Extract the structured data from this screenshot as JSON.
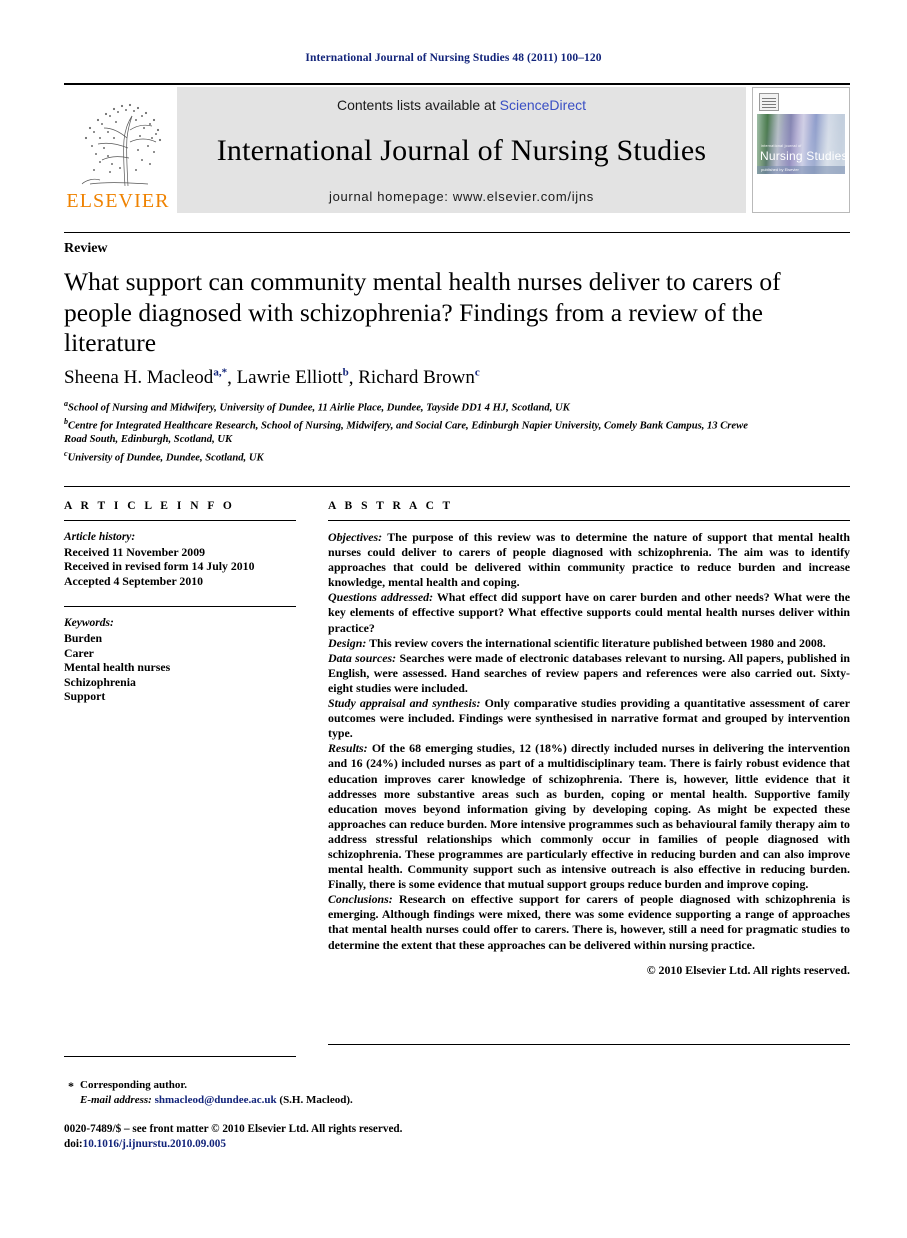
{
  "running_head": "International Journal of Nursing Studies 48 (2011) 100–120",
  "masthead": {
    "publisher_logo_text": "ELSEVIER",
    "contents_prefix": "Contents lists available at ",
    "sciencedirect": "ScienceDirect",
    "journal_title": "International Journal of Nursing Studies",
    "homepage": "journal homepage: www.elsevier.com/ijns",
    "cover": {
      "small_caption": "international journal of",
      "large_caption": "Nursing Studies",
      "band_caption": "published by Elsevier"
    }
  },
  "article": {
    "type": "Review",
    "title": "What support can community mental health nurses deliver to carers of people diagnosed with schizophrenia? Findings from a review of the literature",
    "authors": [
      {
        "name": "Sheena H. Macleod",
        "marks": "a,*"
      },
      {
        "name": "Lawrie Elliott",
        "marks": "b"
      },
      {
        "name": "Richard Brown",
        "marks": "c"
      }
    ],
    "affiliations": [
      {
        "mark": "a",
        "text": "School of Nursing and Midwifery, University of Dundee, 11 Airlie Place, Dundee, Tayside DD1 4 HJ, Scotland, UK"
      },
      {
        "mark": "b",
        "text": "Centre for Integrated Healthcare Research, School of Nursing, Midwifery, and Social Care, Edinburgh Napier University, Comely Bank Campus, 13 Crewe Road South, Edinburgh, Scotland, UK"
      },
      {
        "mark": "c",
        "text": "University of Dundee, Dundee, Scotland, UK"
      }
    ]
  },
  "article_info": {
    "heading": "A R T I C L E   I N F O",
    "history_label": "Article history:",
    "history": [
      "Received 11 November 2009",
      "Received in revised form 14 July 2010",
      "Accepted 4 September 2010"
    ],
    "keywords_label": "Keywords:",
    "keywords": [
      "Burden",
      "Carer",
      "Mental health nurses",
      "Schizophrenia",
      "Support"
    ]
  },
  "abstract": {
    "heading": "A B S T R A C T",
    "sections": [
      {
        "label": "Objectives:",
        "text": "The purpose of this review was to determine the nature of support that mental health nurses could deliver to carers of people diagnosed with schizophrenia. The aim was to identify approaches that could be delivered within community practice to reduce burden and increase knowledge, mental health and coping."
      },
      {
        "label": "Questions addressed:",
        "text": "What effect did support have on carer burden and other needs? What were the key elements of effective support? What effective supports could mental health nurses deliver within practice?"
      },
      {
        "label": "Design:",
        "text": "This review covers the international scientific literature published between 1980 and 2008."
      },
      {
        "label": "Data sources:",
        "text": "Searches were made of electronic databases relevant to nursing. All papers, published in English, were assessed. Hand searches of review papers and references were also carried out. Sixty-eight studies were included."
      },
      {
        "label": "Study appraisal and synthesis:",
        "text": "Only comparative studies providing a quantitative assessment of carer outcomes were included. Findings were synthesised in narrative format and grouped by intervention type."
      },
      {
        "label": "Results:",
        "text": "Of the 68 emerging studies, 12 (18%) directly included nurses in delivering the intervention and 16 (24%) included nurses as part of a multidisciplinary team. There is fairly robust evidence that education improves carer knowledge of schizophrenia. There is, however, little evidence that it addresses more substantive areas such as burden, coping or mental health. Supportive family education moves beyond information giving by developing coping. As might be expected these approaches can reduce burden. More intensive programmes such as behavioural family therapy aim to address stressful relationships which commonly occur in families of people diagnosed with schizophrenia. These programmes are particularly effective in reducing burden and can also improve mental health. Community support such as intensive outreach is also effective in reducing burden. Finally, there is some evidence that mutual support groups reduce burden and improve coping."
      },
      {
        "label": "Conclusions:",
        "text": "Research on effective support for carers of people diagnosed with schizophrenia is emerging. Although findings were mixed, there was some evidence supporting a range of approaches that mental health nurses could offer to carers. There is, however, still a need for pragmatic studies to determine the extent that these approaches can be delivered within nursing practice."
      }
    ],
    "copyright": "© 2010 Elsevier Ltd. All rights reserved."
  },
  "footnotes": {
    "corresponding_marker": "*",
    "corresponding_author": "Corresponding author.",
    "email_label": "E-mail address:",
    "email": "shmacleod@dundee.ac.uk",
    "email_owner": "(S.H. Macleod)."
  },
  "footer": {
    "issn_line": "0020-7489/$ – see front matter © 2010 Elsevier Ltd. All rights reserved.",
    "doi_label": "doi:",
    "doi": "10.1016/j.ijnurstu.2010.09.005"
  },
  "colors": {
    "running_head": "#12247a",
    "elsevier_orange": "#ef8200",
    "sciencedirect_blue": "#3a4fc4",
    "link_blue": "#12247a",
    "masthead_bg": "#e3e3e3"
  }
}
